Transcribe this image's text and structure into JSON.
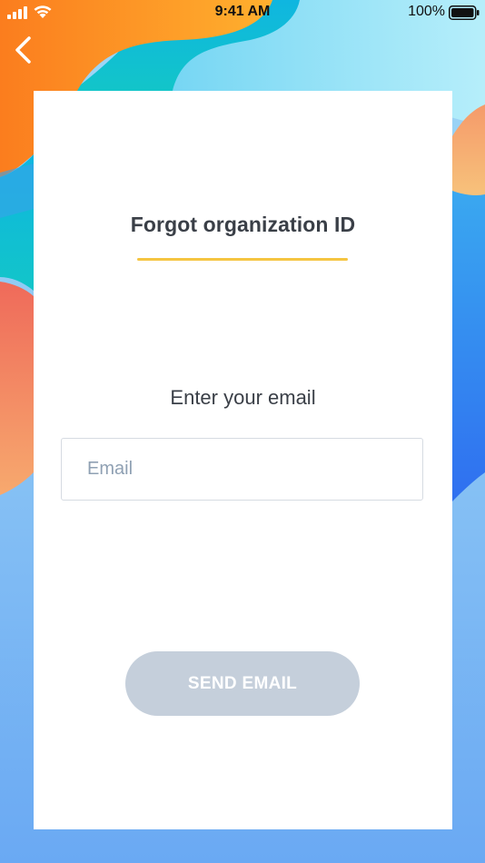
{
  "status_bar": {
    "time": "9:41 AM",
    "battery_percent": "100%"
  },
  "navigation": {
    "back_icon": "chevron-left-icon"
  },
  "card": {
    "title": "Forgot organization ID",
    "prompt": "Enter your email",
    "email_placeholder": "Email",
    "email_value": "",
    "send_button_label": "SEND EMAIL"
  },
  "colors": {
    "title_underline": "#f5c542",
    "send_button_disabled": "#c5cfdb",
    "text": "#3a3f47",
    "placeholder": "#8fa0b3"
  }
}
